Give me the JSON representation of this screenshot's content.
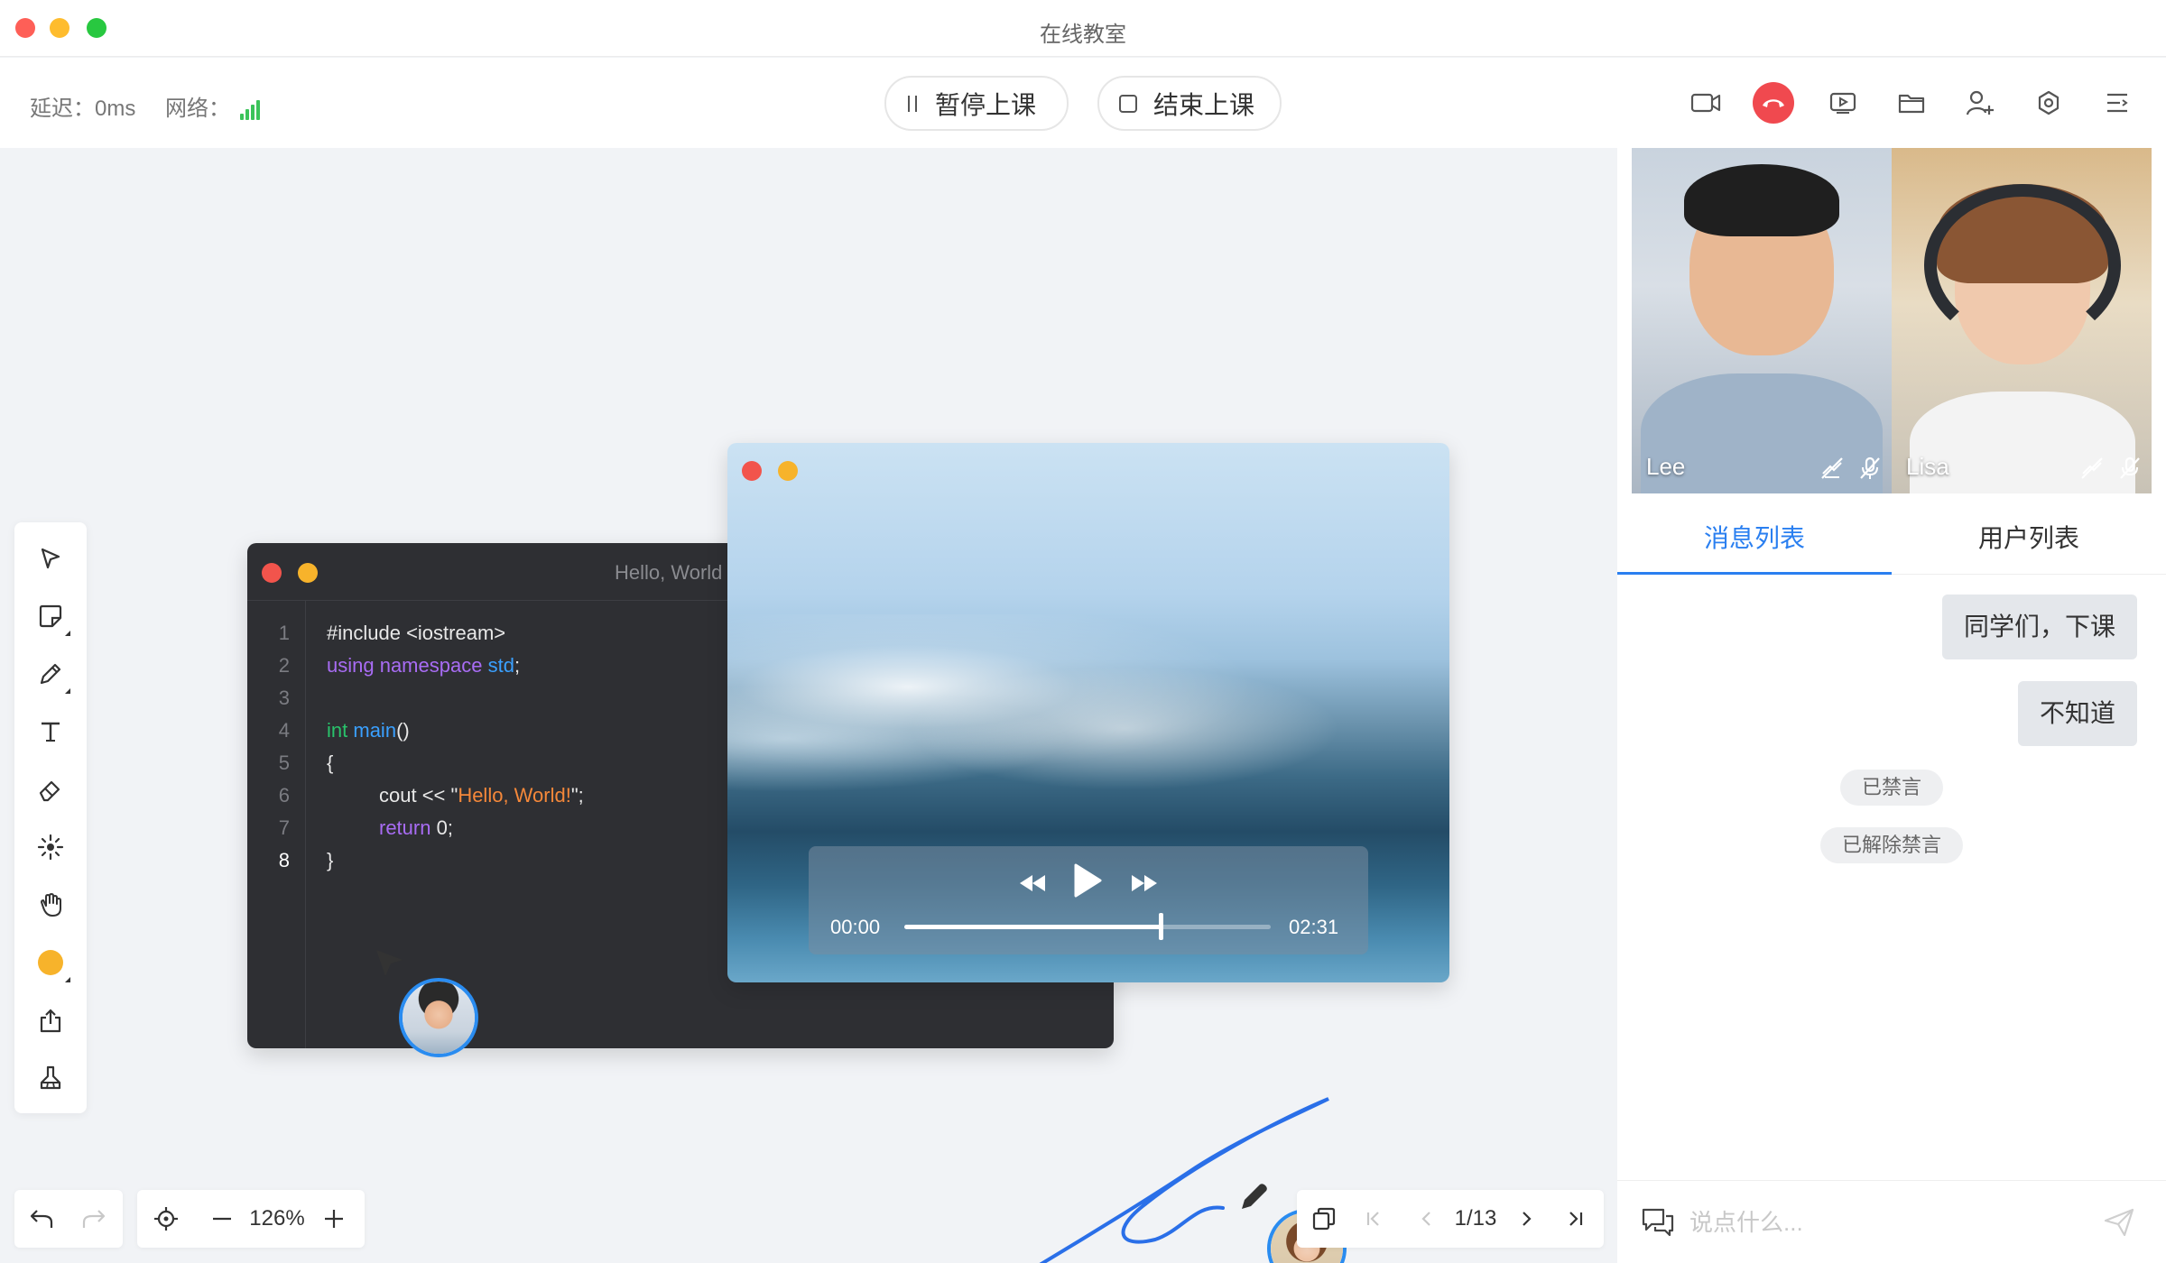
{
  "window": {
    "title": "在线教室"
  },
  "toolbar": {
    "latency_label": "延迟：0ms",
    "network_label": "网络：",
    "pause_label": "暂停上课",
    "end_label": "结束上课",
    "icons": [
      "camera-icon",
      "hangup-icon",
      "screen-share-icon",
      "folder-icon",
      "add-user-icon",
      "settings-icon",
      "menu-icon"
    ],
    "accent_red": "#f0494f"
  },
  "tools": [
    "select-arrow-icon",
    "note-icon",
    "pen-icon",
    "text-icon",
    "eraser-icon",
    "laser-icon",
    "hand-icon",
    "color-swatch",
    "upload-icon",
    "clear-icon"
  ],
  "code_window": {
    "title": "Hello, World",
    "line_numbers": [
      "1",
      "2",
      "3",
      "4",
      "5",
      "6",
      "7",
      "8"
    ],
    "l1": "#include <iostream>",
    "l2_kw": "using namespace",
    "l2_ns": "std",
    "l4_type": "int",
    "l4_fn": "main",
    "l6_pre": "cout << \"",
    "l6_str": "Hello, World!",
    "l6_post": "\";",
    "l7_kw": "return",
    "l7_post": " 0;"
  },
  "video_player": {
    "current_time": "00:00",
    "total_time": "02:31",
    "progress": 0.7
  },
  "canvas_controls": {
    "zoom": "126%",
    "page": "1/13"
  },
  "participants": [
    {
      "name": "Lee"
    },
    {
      "name": "Lisa"
    }
  ],
  "chat": {
    "tab_messages": "消息列表",
    "tab_users": "用户列表",
    "messages": [
      "同学们，下课",
      "不知道"
    ],
    "system": [
      "已禁言",
      "已解除禁言"
    ],
    "input_placeholder": "说点什么..."
  }
}
